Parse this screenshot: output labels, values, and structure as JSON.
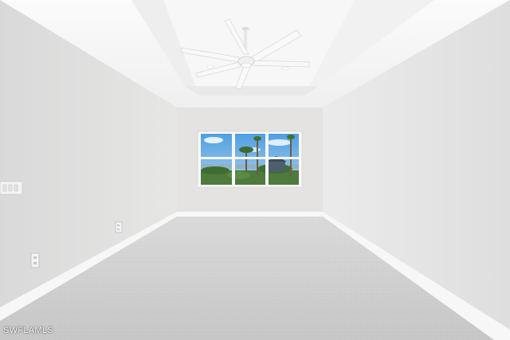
{
  "photo": {
    "subject": "empty-room",
    "watermark": "SWFLAMLS"
  },
  "colors": {
    "wall_left": "#dfdfdf",
    "wall_right": "#e6e6e6",
    "back_wall": "#e4e3e1",
    "ceiling": "#f4f4f4",
    "carpet": "#cfcfd0",
    "baseboard": "#f7f7f7",
    "sky": "#5aa8e6"
  },
  "icons": [
    "ceiling-fan-icon",
    "light-switch-icon",
    "outlet-icon"
  ]
}
